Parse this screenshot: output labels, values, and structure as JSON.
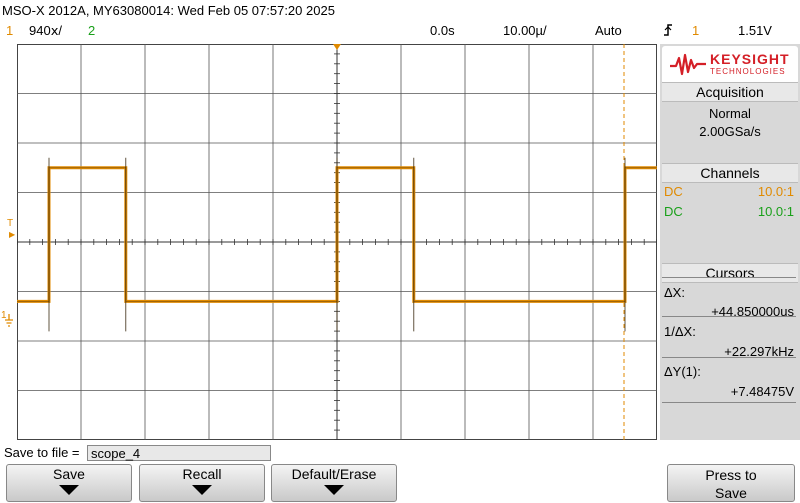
{
  "header": {
    "title": "MSO-X 2012A, MY63080014: Wed Feb 05 07:57:20 2025"
  },
  "status": {
    "ch1_number": "1",
    "ch1_scale": "940ⅹ/",
    "ch2_number": "2",
    "delay": "0.0s",
    "timebase": "10.00µ/",
    "trigger_mode": "Auto",
    "trigger_channel": "1",
    "trigger_level": "1.51V"
  },
  "colors": {
    "ch1": "#e08a00",
    "ch2": "#1aa01a"
  },
  "panel": {
    "brand": "KEYSIGHT",
    "brand_sub": "TECHNOLOGIES",
    "acquisition": {
      "heading": "Acquisition",
      "mode": "Normal",
      "rate": "2.00GSa/s"
    },
    "channels": {
      "heading": "Channels",
      "rows": [
        {
          "coupling": "DC",
          "probe": "10.0:1"
        },
        {
          "coupling": "DC",
          "probe": "10.0:1"
        }
      ]
    },
    "cursors": {
      "heading": "Cursors",
      "dx_label": "ΔX:",
      "dx_value": "+44.850000us",
      "inv_dx_label": "1/ΔX:",
      "inv_dx_value": "+22.297kHz",
      "dy_label": "ΔY(1):",
      "dy_value": "+7.48475V"
    }
  },
  "save": {
    "label": "Save to file =",
    "filename": "scope_4"
  },
  "softkeys": {
    "save": "Save",
    "recall": "Recall",
    "default_erase": "Default/Erase",
    "press_line1": "Press to",
    "press_line2": "Save"
  },
  "markers": {
    "trigger_level_marker": "T",
    "ch1_ground_marker": "1"
  },
  "waveform": {
    "channel": "1",
    "shape": "square",
    "high_division": 1.5,
    "low_division": -1.2,
    "transitions_division": [
      0.5,
      1.7,
      5.0,
      6.2,
      9.5
    ]
  }
}
